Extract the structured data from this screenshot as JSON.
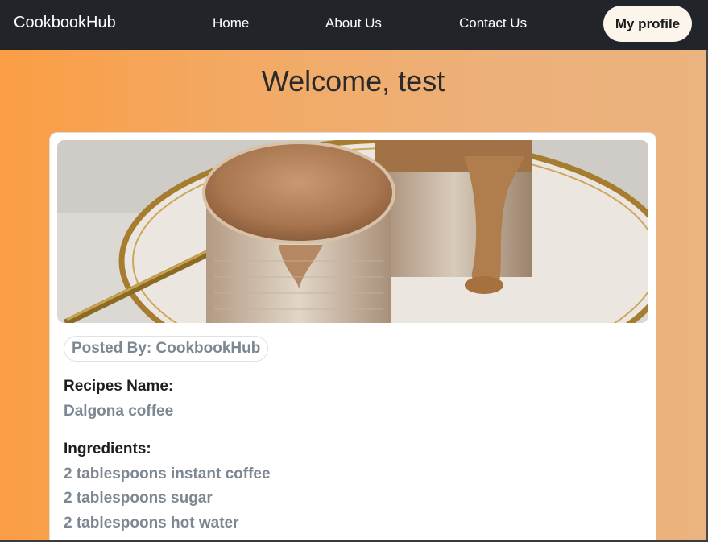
{
  "navbar": {
    "brand": "CookbookHub",
    "links": [
      "Home",
      "About Us",
      "Contact Us"
    ],
    "profile_button": "My profile"
  },
  "page": {
    "welcome": "Welcome, test"
  },
  "recipe": {
    "posted_by": "Posted By: CookbookHub",
    "name_label": "Recipes Name:",
    "name": "Dalgona coffee",
    "ingredients_label": "Ingredients:",
    "ingredients": [
      "2 tablespoons instant coffee",
      "2 tablespoons sugar",
      "2 tablespoons hot water"
    ]
  },
  "colors": {
    "navbar": "#212529",
    "gradient_start": "#fb9d45",
    "gradient_end": "#ebb37f",
    "muted_text": "#7c8791"
  }
}
